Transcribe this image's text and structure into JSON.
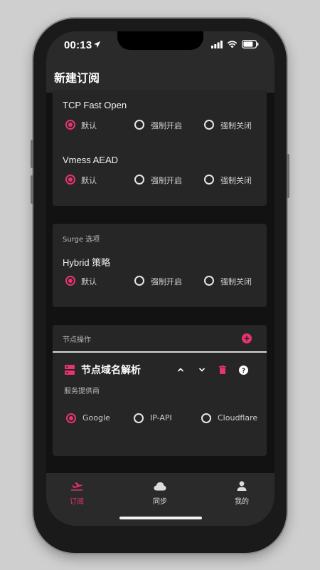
{
  "status_bar": {
    "time": "00:13"
  },
  "app_bar": {
    "title": "新建订阅"
  },
  "card_general": {
    "settings": [
      {
        "title": "TCP Fast Open",
        "options": [
          "默认",
          "强制开启",
          "强制关闭"
        ],
        "selected": 0
      },
      {
        "title": "Vmess AEAD",
        "options": [
          "默认",
          "强制开启",
          "强制关闭"
        ],
        "selected": 0
      }
    ]
  },
  "card_surge": {
    "section_label": "Surge 选项",
    "settings": [
      {
        "title": "Hybrid 策略",
        "options": [
          "默认",
          "强制开启",
          "强制关闭"
        ],
        "selected": 0
      }
    ]
  },
  "card_node": {
    "section_label": "节点操作",
    "operation": {
      "title": "节点域名解析",
      "provider_label": "服务提供商",
      "options": [
        "Google",
        "IP-API",
        "Cloudflare"
      ],
      "selected": 0
    }
  },
  "tab_bar": {
    "tabs": [
      {
        "label": "订阅",
        "icon": "airplane-icon",
        "active": true
      },
      {
        "label": "同步",
        "icon": "cloud-icon",
        "active": false
      },
      {
        "label": "我的",
        "icon": "person-icon",
        "active": false
      }
    ]
  },
  "colors": {
    "accent": "#e8336d",
    "card": "#262626",
    "background": "#121212",
    "bar": "#2a2a2a"
  }
}
